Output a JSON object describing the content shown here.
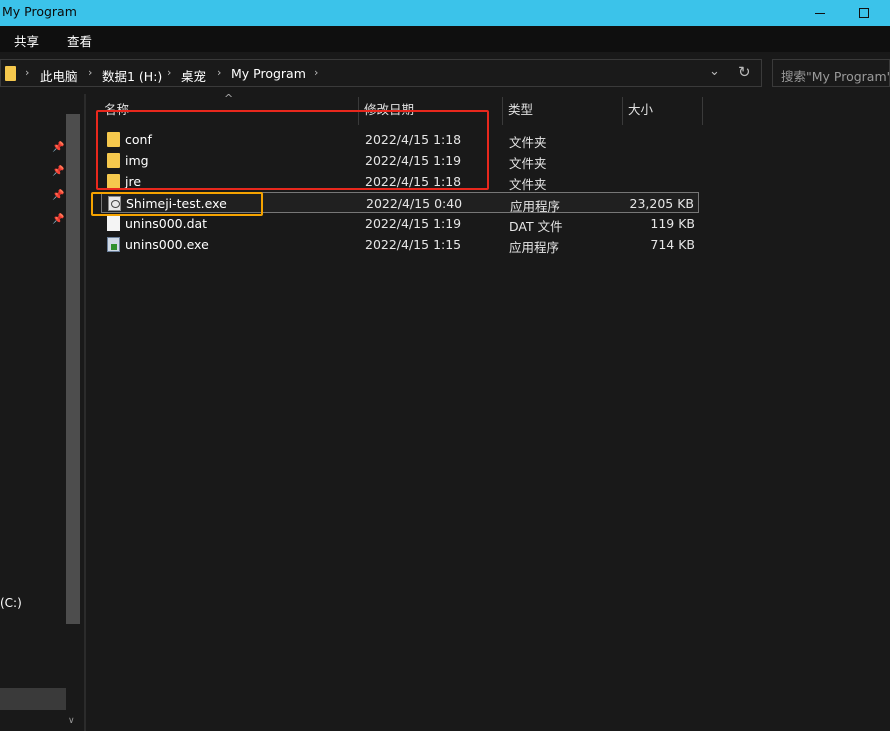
{
  "window": {
    "title": "My Program"
  },
  "ribbon": {
    "tabs": [
      "共享",
      "查看"
    ]
  },
  "address": {
    "crumbs": [
      "此电脑",
      "数据1 (H:)",
      "桌宠",
      "My Program"
    ]
  },
  "search": {
    "placeholder": "搜索\"My Program\""
  },
  "nav": {
    "drive_label": "(C:)"
  },
  "columns": {
    "name": "名称",
    "modified": "修改日期",
    "type": "类型",
    "size": "大小"
  },
  "files": [
    {
      "name": "conf",
      "date": "2022/4/15 1:18",
      "type": "文件夹",
      "size": "",
      "icon": "folder-icon"
    },
    {
      "name": "img",
      "date": "2022/4/15 1:19",
      "type": "文件夹",
      "size": "",
      "icon": "folder-icon"
    },
    {
      "name": "jre",
      "date": "2022/4/15 1:18",
      "type": "文件夹",
      "size": "",
      "icon": "folder-icon"
    },
    {
      "name": "Shimeji-test.exe",
      "date": "2022/4/15 0:40",
      "type": "应用程序",
      "size": "23,205 KB",
      "icon": "application-icon"
    },
    {
      "name": "unins000.dat",
      "date": "2022/4/15 1:19",
      "type": "DAT 文件",
      "size": "119 KB",
      "icon": "file-icon"
    },
    {
      "name": "unins000.exe",
      "date": "2022/4/15 1:15",
      "type": "应用程序",
      "size": "714 KB",
      "icon": "installer-icon"
    }
  ],
  "colors": {
    "titlebar": "#3bc3ea",
    "background": "#191919",
    "highlight_red": "#e8281d",
    "highlight_orange": "#f5a300",
    "folder": "#f5c84d"
  }
}
